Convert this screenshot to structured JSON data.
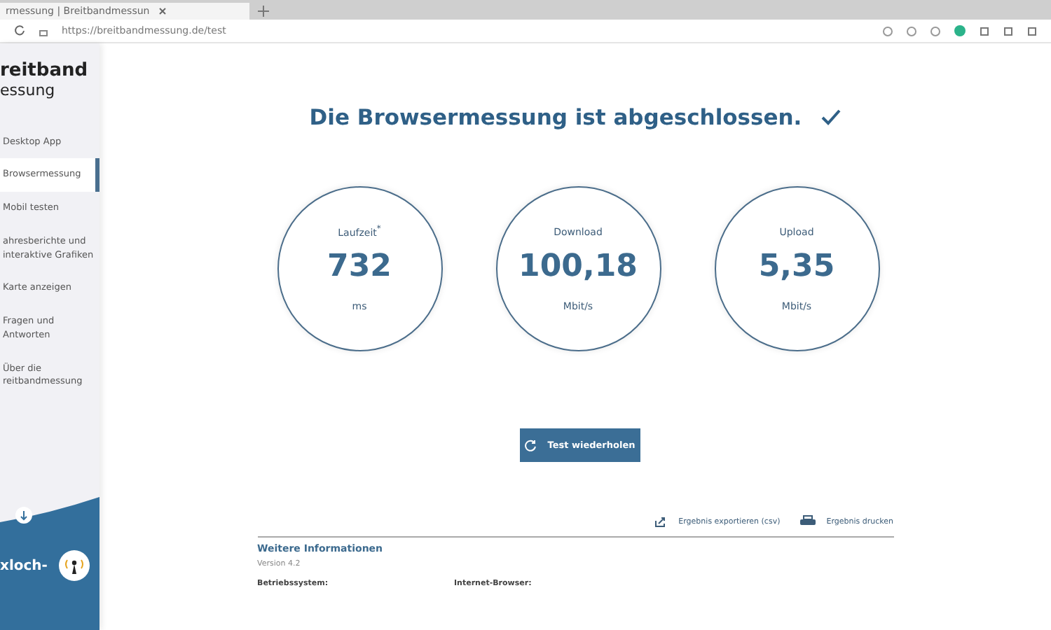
{
  "browser": {
    "tab_title": "rmessung | Breitbandmessun",
    "address": "https://breitbandmessung.de/test"
  },
  "sidebar": {
    "logo_top": "reitband",
    "logo_bottom": "essung",
    "items": [
      {
        "label": "Desktop App",
        "selected": false
      },
      {
        "label": "Browsermessung",
        "selected": true
      },
      {
        "label": "Mobil testen",
        "selected": false
      },
      {
        "label": "ahresberichte und\ninteraktive Grafiken",
        "selected": false
      },
      {
        "label": "Karte anzeigen",
        "selected": false
      },
      {
        "label": "Fragen und Antworten",
        "selected": false
      },
      {
        "label": "Über die\nreitbandmessung",
        "selected": false
      }
    ],
    "promo": "xloch-"
  },
  "heading": "Die Browsermessung ist abgeschlossen.",
  "results": [
    {
      "label": "Laufzeit$^{*}$",
      "value": "732",
      "unit": "ms"
    },
    {
      "label": "Download",
      "value": "100,18",
      "unit": "Mbit/s"
    },
    {
      "label": "Upload",
      "value": "5,35",
      "unit": "Mbit/s"
    }
  ],
  "repeat_button": "Test wiederholen",
  "actions": [
    {
      "kind": "export",
      "label": "Ergebnis exportieren (csv)"
    },
    {
      "kind": "print",
      "label": "Ergebnis drucken"
    }
  ],
  "info": {
    "title": "Weitere Informationen",
    "version": "Version 4.2",
    "fields": [
      "Betriebssystem:",
      "Internet-Browser:"
    ]
  }
}
